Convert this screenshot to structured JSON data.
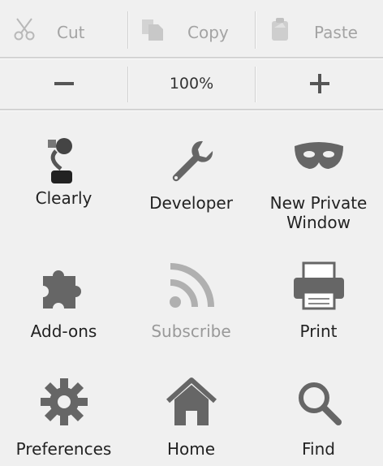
{
  "edit": {
    "cut": "Cut",
    "copy": "Copy",
    "paste": "Paste"
  },
  "zoom": {
    "level": "100%",
    "minus_icon": "minus-icon",
    "plus_icon": "plus-icon"
  },
  "items": [
    {
      "label": "Clearly",
      "icon": "clearly-lamp-icon"
    },
    {
      "label": "Developer",
      "icon": "wrench-icon"
    },
    {
      "label": "New Private Window",
      "icon": "mask-icon"
    },
    {
      "label": "Add-ons",
      "icon": "puzzle-icon"
    },
    {
      "label": "Subscribe",
      "icon": "rss-icon"
    },
    {
      "label": "Print",
      "icon": "printer-icon"
    },
    {
      "label": "Preferences",
      "icon": "gear-icon"
    },
    {
      "label": "Home",
      "icon": "home-icon"
    },
    {
      "label": "Find",
      "icon": "search-icon"
    }
  ],
  "colors": {
    "background": "#f0f0f0",
    "icon": "#666666",
    "disabled": "#aaaaaa"
  }
}
